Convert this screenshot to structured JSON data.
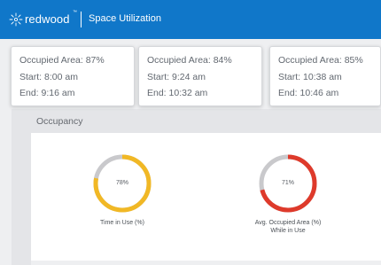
{
  "header": {
    "brand": "redwood",
    "brand_mark": "™",
    "title": "Space Utilization",
    "bg_color": "#1077c9"
  },
  "cards": [
    {
      "occupied": "Occupied Area: 87%",
      "start": "Start: 8:00 am",
      "end": "End: 9:16 am"
    },
    {
      "occupied": "Occupied Area: 84%",
      "start": "Start: 9:24 am",
      "end": "End: 10:32 am"
    },
    {
      "occupied": "Occupied Area: 85%",
      "start": "Start: 10:38 am",
      "end": "End: 10:46 am"
    }
  ],
  "panel": {
    "title": "Occupancy"
  },
  "donuts": [
    {
      "value": 78,
      "label": "78%",
      "caption": [
        "Time in Use (%)"
      ],
      "color": "#f1b825",
      "track": "#c9c9cc"
    },
    {
      "value": 71,
      "label": "71%",
      "caption": [
        "Avg. Occupied Area (%)",
        "While in Use"
      ],
      "color": "#de3a2b",
      "track": "#c9c9cc"
    }
  ]
}
